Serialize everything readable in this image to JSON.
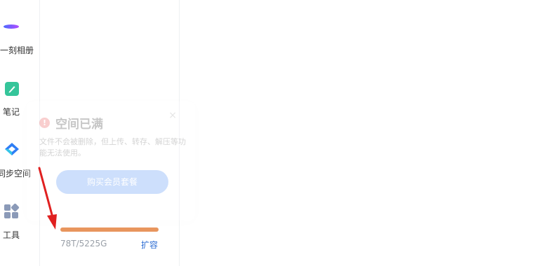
{
  "sidebar": {
    "items": [
      {
        "label": "一刻相册",
        "icon": "moment-album-icon"
      },
      {
        "label": "笔记",
        "icon": "note-icon"
      },
      {
        "label": "同步空间",
        "icon": "sync-space-icon"
      },
      {
        "label": "工具",
        "icon": "tools-icon"
      }
    ]
  },
  "popup": {
    "title": "空间已满",
    "warning_icon": "!",
    "close_icon": "×",
    "description": "文件不会被删除，但上传、转存、解压等功能无法使用。",
    "button_label": "购买会员套餐"
  },
  "storage": {
    "usage_text": "78T/5225G",
    "used_fraction": 1.0,
    "fill_color": "#e8955d",
    "expand_label": "扩容"
  },
  "colors": {
    "accent": "#2f6ed3",
    "annotation": "#e02020"
  }
}
